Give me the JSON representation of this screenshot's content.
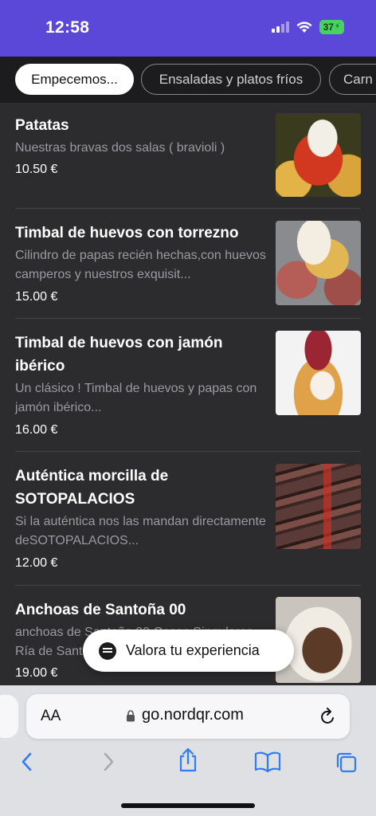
{
  "status_bar": {
    "time": "12:58",
    "battery": "37"
  },
  "categories": [
    {
      "label": "Empecemos...",
      "active": true
    },
    {
      "label": "Ensaladas y platos fríos",
      "active": false
    },
    {
      "label": "Carn",
      "active": false
    }
  ],
  "items": [
    {
      "name": "Patatas",
      "description": "Nuestras bravas dos salas ( bravioli )",
      "price": "10.50 €",
      "image": "patatas-bravas-photo"
    },
    {
      "name": "Timbal de huevos con torrezno",
      "description": "Cilindro de papas recién hechas,con huevos camperos y nuestros exquisit...",
      "price": "15.00 €",
      "image": "timbal-torrezno-photo"
    },
    {
      "name": "Timbal de huevos con jamón ibérico",
      "description": "Un clásico ! Timbal de huevos y papas con jamón ibérico...",
      "price": "16.00 €",
      "image": "timbal-jamon-photo"
    },
    {
      "name": "Auténtica morcilla de SOTOPALACIOS",
      "description": "Si la auténtica nos las mandan directamente deSOTOPALACIOS...",
      "price": "12.00 €",
      "image": "morcilla-photo"
    },
    {
      "name": "Anchoas de Santoña 00",
      "description": "anchoas de Santoña 00 Cosas Singulares Ría de Santoña",
      "price": "19.00 €",
      "image": "anchoas-photo"
    }
  ],
  "feedback_button": {
    "label": "Valora tu experiencia"
  },
  "browser": {
    "aa_label": "AA",
    "url": "go.nordqr.com"
  },
  "colors": {
    "header": "#5b48d9",
    "list_bg": "#2c2c2e",
    "safari_blue": "#2f7cf6"
  }
}
